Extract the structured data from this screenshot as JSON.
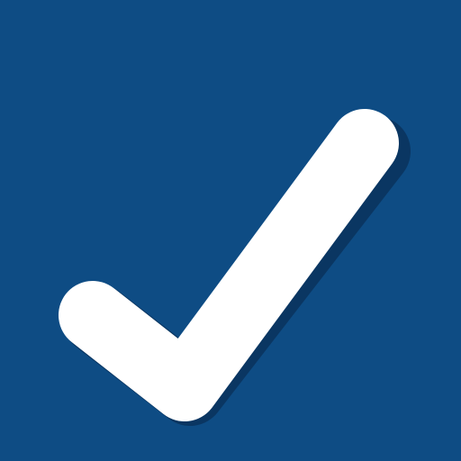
{
  "icon": {
    "name": "checkmark-icon",
    "background_color": "#0e4c84",
    "check_color": "#ffffff",
    "shadow_color": "#0a2f57"
  }
}
